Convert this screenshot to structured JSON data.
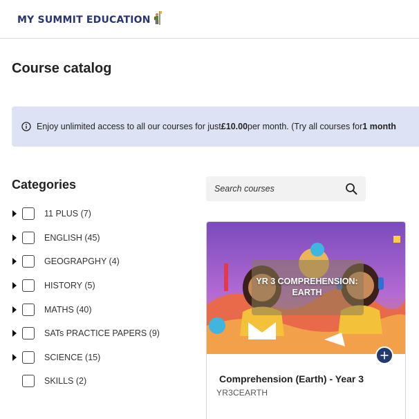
{
  "header": {
    "logo_text": "MY SUMMIT EDUCATION",
    "logo_icon": "hiker-flag-icon"
  },
  "page": {
    "title": "Course catalog"
  },
  "banner": {
    "icon": "info-icon",
    "text_before": "Enjoy unlimited access to all our courses for just ",
    "price": "£10.00",
    "text_middle": " per month. (Try all courses for ",
    "trial": "1 month"
  },
  "categories": {
    "title": "Categories",
    "items": [
      {
        "label": "11 PLUS (7)",
        "expandable": true
      },
      {
        "label": "ENGLISH (45)",
        "expandable": true
      },
      {
        "label": "GEOGRAPGHY (4)",
        "expandable": true
      },
      {
        "label": "HISTORY (5)",
        "expandable": true
      },
      {
        "label": "MATHS (40)",
        "expandable": true
      },
      {
        "label": "SATs PRACTICE PAPERS (9)",
        "expandable": true
      },
      {
        "label": "SCIENCE (15)",
        "expandable": true
      },
      {
        "label": "SKILLS (2)",
        "expandable": false
      }
    ]
  },
  "search": {
    "placeholder": "Search courses",
    "value": ""
  },
  "course_card": {
    "image_text": "YR 3 COMPREHENSION: EARTH",
    "title": "Comprehension (Earth) - Year 3",
    "code": "YR3CEARTH",
    "add_icon": "plus-icon"
  },
  "colors": {
    "brand_navy": "#2a3470",
    "banner_bg": "#dde3f4",
    "add_button": "#243a6b"
  }
}
